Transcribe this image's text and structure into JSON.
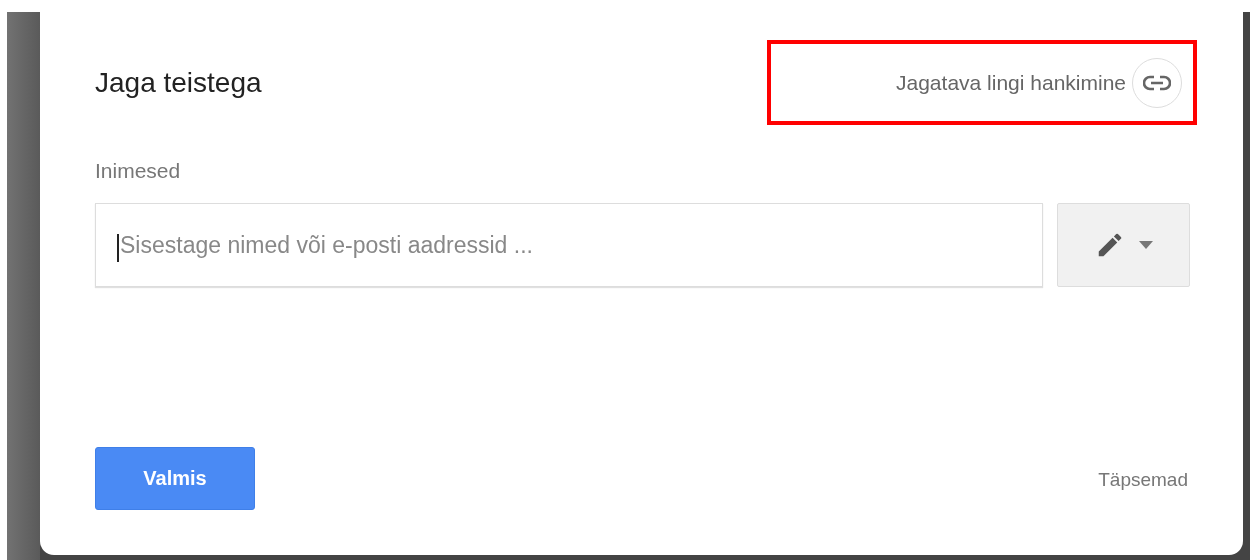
{
  "dialog": {
    "title": "Jaga teistega",
    "share_link": {
      "label": "Jagatava lingi hankimine",
      "highlighted": true
    },
    "people": {
      "label": "Inimesed",
      "input": {
        "placeholder": "Sisestage nimed või e-posti aadressid ...",
        "focused": true
      }
    },
    "done_button": "Valmis",
    "advanced_link": "Täpsemad"
  }
}
